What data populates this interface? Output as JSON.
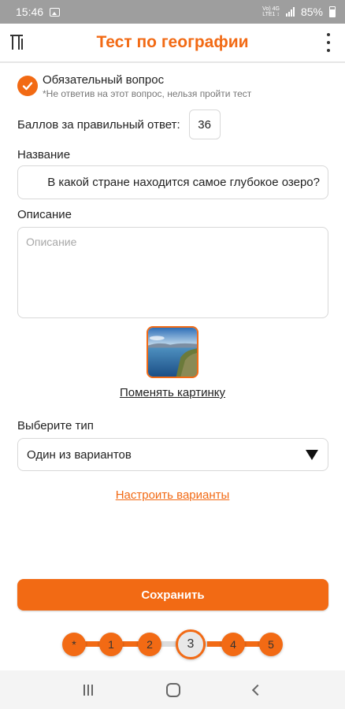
{
  "status_bar": {
    "time": "15:46",
    "volte_line1": "Vo) 4G",
    "volte_line2": "LTE1 ↕",
    "battery": "85%"
  },
  "app_bar": {
    "title": "Тест по географии",
    "logo_icon": "test-logo-icon",
    "menu_icon": "more-vert-icon"
  },
  "required": {
    "checked": true,
    "title": "Обязательный вопрос",
    "subtitle": "*Не ответив на этот вопрос, нельзя пройти тест"
  },
  "score": {
    "label": "Баллов за правильный ответ:",
    "value": "36"
  },
  "name_field": {
    "label": "Название",
    "value": "В какой стране находится самое глубокое озеро?"
  },
  "description_field": {
    "label": "Описание",
    "placeholder": "Описание"
  },
  "picture": {
    "change_link": "Поменять картинку"
  },
  "type_select": {
    "label": "Выберите тип",
    "value": "Один из вариантов"
  },
  "configure_link": "Настроить варианты",
  "save_button": "Сохранить",
  "stepper": {
    "steps": [
      "*",
      "1",
      "2",
      "3",
      "4",
      "5"
    ],
    "active_step": "3"
  },
  "colors": {
    "accent": "#f26a14",
    "status_bar": "#9e9e9e"
  }
}
